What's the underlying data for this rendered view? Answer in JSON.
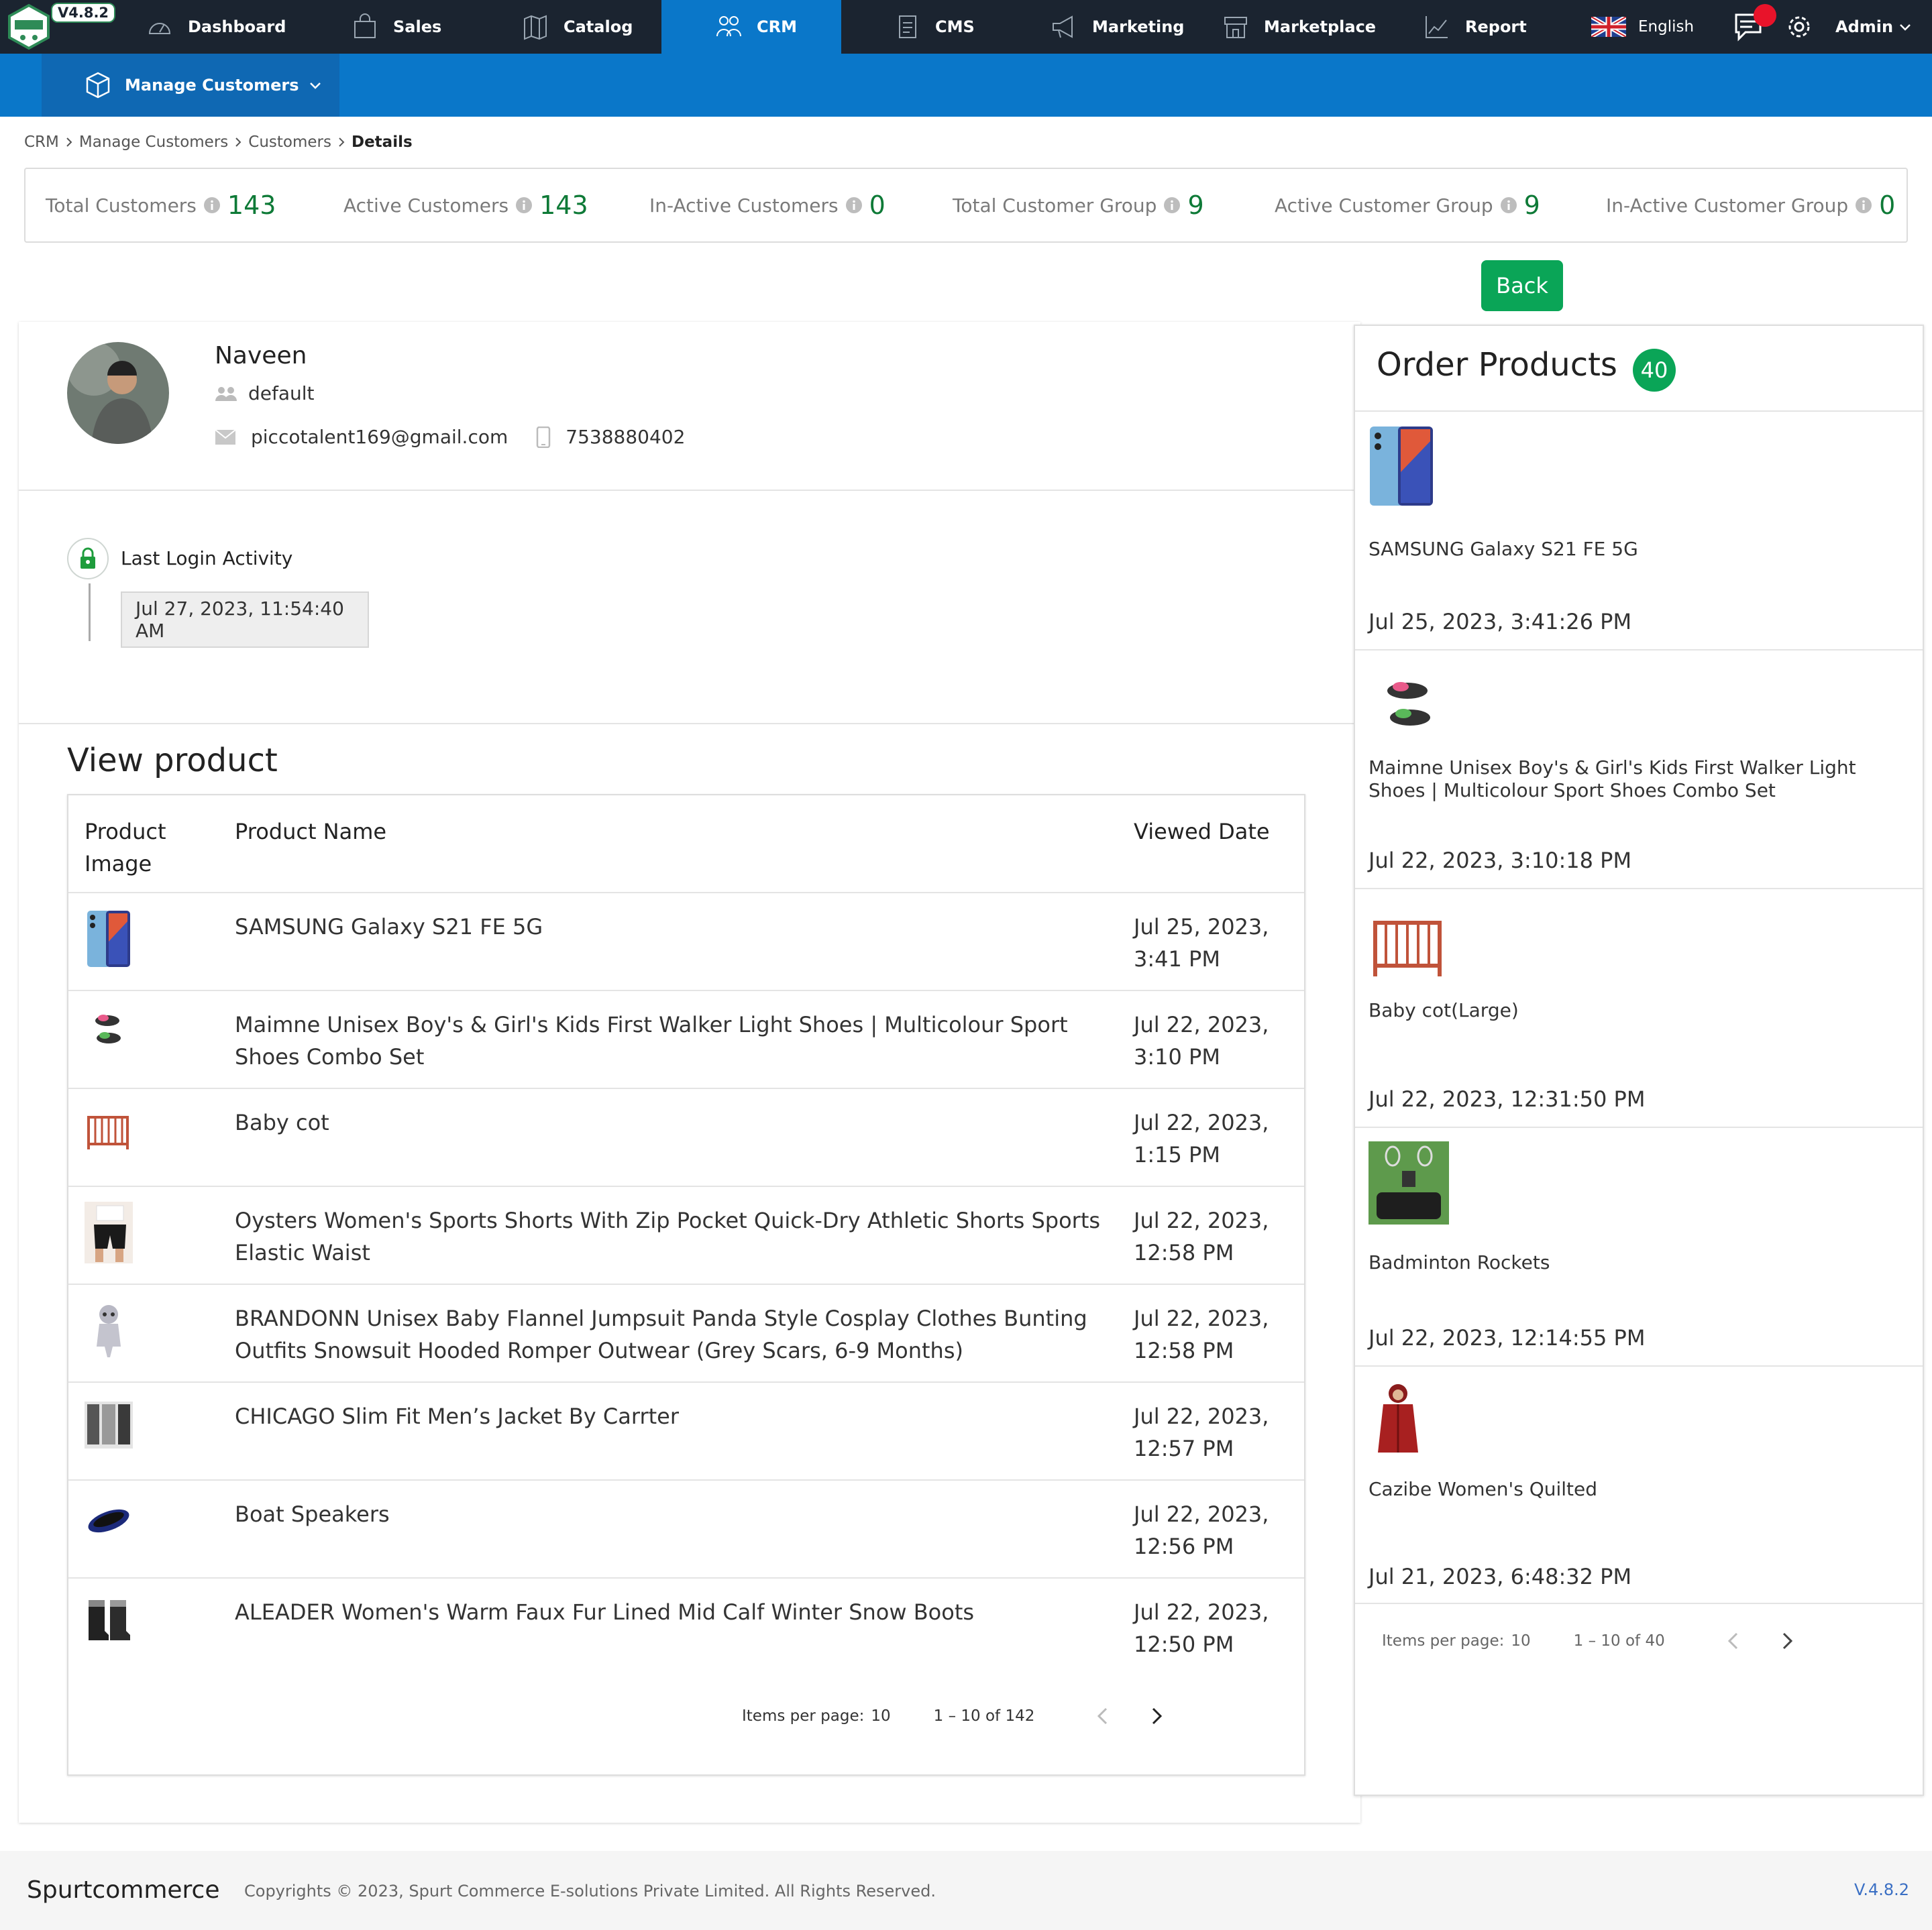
{
  "app": {
    "version_badge": "V4.8.2"
  },
  "nav": {
    "items": [
      {
        "label": "Dashboard",
        "icon": "dashboard-icon"
      },
      {
        "label": "Sales",
        "icon": "shopping-bag-icon"
      },
      {
        "label": "Catalog",
        "icon": "map-icon"
      },
      {
        "label": "CRM",
        "icon": "users-icon"
      },
      {
        "label": "CMS",
        "icon": "document-icon"
      },
      {
        "label": "Marketing",
        "icon": "megaphone-icon"
      },
      {
        "label": "Marketplace",
        "icon": "store-icon"
      },
      {
        "label": "Report",
        "icon": "chart-line-icon"
      }
    ],
    "active": "CRM",
    "language": "English",
    "user": "Admin"
  },
  "subnav": {
    "label": "Manage Customers"
  },
  "breadcrumb": [
    "CRM",
    "Manage Customers",
    "Customers",
    "Details"
  ],
  "stats": [
    {
      "label": "Total Customers",
      "value": "143"
    },
    {
      "label": "Active Customers",
      "value": "143"
    },
    {
      "label": "In-Active Customers",
      "value": "0"
    },
    {
      "label": "Total Customer Group",
      "value": "9"
    },
    {
      "label": "Active Customer Group",
      "value": "9"
    },
    {
      "label": "In-Active Customer Group",
      "value": "0"
    }
  ],
  "back_label": "Back",
  "customer": {
    "name": "Naveen",
    "group": "default",
    "email": "piccotalent169@gmail.com",
    "phone": "7538880402"
  },
  "login": {
    "title": "Last Login Activity",
    "time": "Jul 27, 2023, 11:54:40 AM"
  },
  "view_products": {
    "title": "View product",
    "columns": [
      "Product Image",
      "Product Name",
      "Viewed Date"
    ],
    "rows": [
      {
        "name": "SAMSUNG Galaxy S21 FE 5G",
        "date": "Jul 25, 2023, 3:41 PM",
        "thumb": "phone-thumb"
      },
      {
        "name": "Maimne Unisex Boy's & Girl's Kids First Walker Light Shoes | Multicolour Sport Shoes Combo Set",
        "date": "Jul 22, 2023, 3:10 PM",
        "thumb": "shoes-thumb"
      },
      {
        "name": "Baby cot",
        "date": "Jul 22, 2023, 1:15 PM",
        "thumb": "cot-thumb"
      },
      {
        "name": "Oysters Women's Sports Shorts With Zip Pocket Quick-Dry Athletic Shorts Sports Elastic Waist",
        "date": "Jul 22, 2023, 12:58 PM",
        "thumb": "shorts-thumb"
      },
      {
        "name": "BRANDONN Unisex Baby Flannel Jumpsuit Panda Style Cosplay Clothes Bunting Outfits Snowsuit Hooded Romper Outwear (Grey Scars, 6-9 Months)",
        "date": "Jul 22, 2023, 12:58 PM",
        "thumb": "jumpsuit-thumb"
      },
      {
        "name": "CHICAGO Slim Fit Men’s Jacket By Carrter",
        "date": "Jul 22, 2023, 12:57 PM",
        "thumb": "jacket-thumb"
      },
      {
        "name": "Boat Speakers",
        "date": "Jul 22, 2023, 12:56 PM",
        "thumb": "speaker-thumb"
      },
      {
        "name": "ALEADER Women's Warm Faux Fur Lined Mid Calf Winter Snow Boots",
        "date": "Jul 22, 2023, 12:50 PM",
        "thumb": "boots-thumb"
      }
    ],
    "pagination": {
      "items_per_page_label": "Items per page:",
      "items_per_page": "10",
      "range": "1 – 10 of 142"
    }
  },
  "order_products": {
    "title": "Order Products",
    "count": "40",
    "items": [
      {
        "name": "SAMSUNG Galaxy S21 FE 5G",
        "date": "Jul 25, 2023, 3:41:26 PM"
      },
      {
        "name": "Maimne Unisex Boy's & Girl's Kids First Walker Light Shoes | Multicolour Sport Shoes Combo Set",
        "date": "Jul 22, 2023, 3:10:18 PM"
      },
      {
        "name": "Baby cot(Large)",
        "date": "Jul 22, 2023, 12:31:50 PM"
      },
      {
        "name": "Badminton Rockets",
        "date": "Jul 22, 2023, 12:14:55 PM"
      },
      {
        "name": "Cazibe Women's Quilted",
        "date": "Jul 21, 2023, 6:48:32 PM"
      }
    ],
    "pagination": {
      "items_per_page_label": "Items per page:",
      "items_per_page": "10",
      "range": "1 – 10 of 40"
    }
  },
  "footer": {
    "brand": "Spurtcommerce",
    "copyright": "Copyrights © 2023, Spurt Commerce E-solutions Private Limited. All Rights Reserved.",
    "version": "V.4.8.2"
  },
  "colors": {
    "topbar": "#1b2430",
    "primary": "#0a77c9",
    "success": "#0aa557",
    "stat_number": "#0e7a37",
    "notify": "#e8132a"
  }
}
